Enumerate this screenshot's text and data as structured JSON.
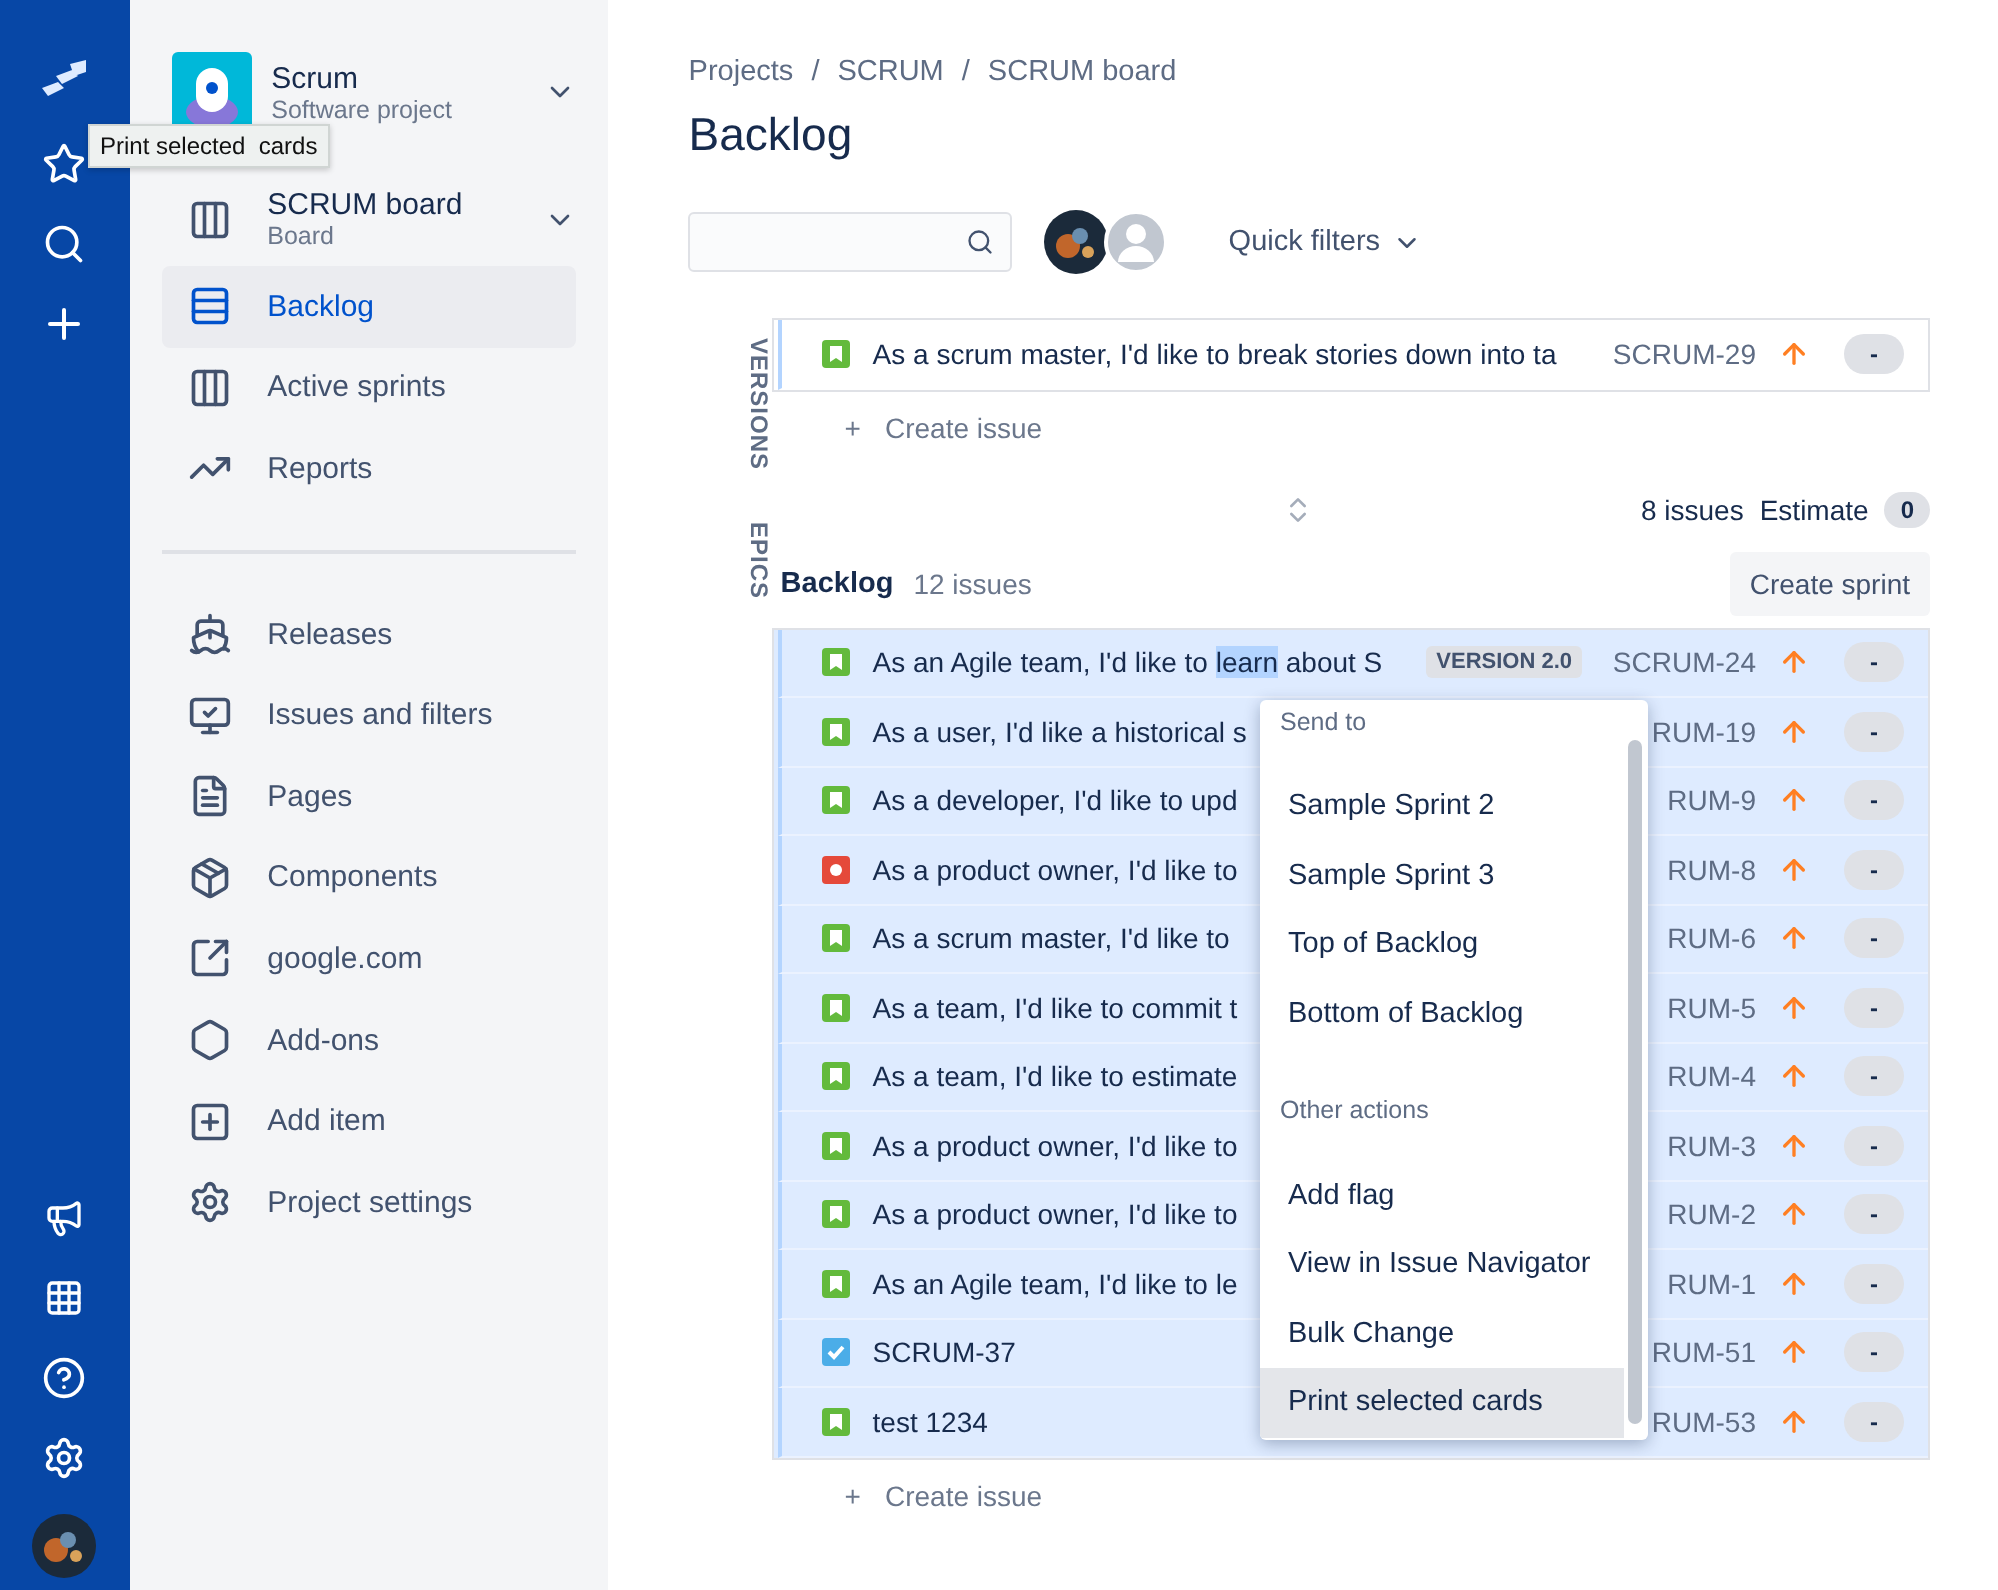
{
  "tooltip": {
    "text": "Print selected  cards"
  },
  "project": {
    "name": "Scrum",
    "type": "Software project"
  },
  "board": {
    "name": "SCRUM board",
    "type": "Board"
  },
  "sidebar": {
    "items": [
      {
        "label": "Backlog",
        "selected": true
      },
      {
        "label": "Active sprints",
        "selected": false
      },
      {
        "label": "Reports",
        "selected": false
      }
    ],
    "more_items": [
      {
        "label": "Releases"
      },
      {
        "label": "Issues and filters"
      },
      {
        "label": "Pages"
      },
      {
        "label": "Components"
      },
      {
        "label": "google.com"
      },
      {
        "label": "Add-ons"
      },
      {
        "label": "Add item"
      },
      {
        "label": "Project settings"
      }
    ]
  },
  "breadcrumbs": [
    {
      "label": "Projects"
    },
    {
      "separator": "/",
      "label": "SCRUM"
    },
    {
      "separator": "/",
      "label": "SCRUM board"
    }
  ],
  "title": "Backlog",
  "toolbar": {
    "quick_filters": "Quick filters"
  },
  "side_tabs": [
    "VERSIONS",
    "EPICS"
  ],
  "sprint": {
    "rows": [
      {
        "kind": "story",
        "summary": "As a scrum master, I'd like to break stories down into ta",
        "key": "SCRUM-29",
        "estimate": "-"
      }
    ],
    "create_issue": "Create issue",
    "create_icon": "+",
    "issues": "8 issues",
    "estimate_label": "Estimate",
    "estimate": "0"
  },
  "backlog": {
    "title": "Backlog",
    "count": "12 issues",
    "create_sprint": "Create sprint",
    "rows": [
      {
        "kind": "story",
        "selected": true,
        "summary": "As an Agile team, I'd like to ",
        "selected_text": "learn",
        "summary_end": " about S",
        "version": "VERSION 2.0",
        "key": "SCRUM-24",
        "estimate": "-"
      },
      {
        "kind": "story",
        "selected": true,
        "summary": "As a user, I'd like a historical s",
        "key": "RUM-19",
        "estimate": "-"
      },
      {
        "kind": "story",
        "selected": true,
        "summary": "As a developer, I'd like to upd",
        "key": "RUM-9",
        "estimate": "-"
      },
      {
        "kind": "bug",
        "selected": true,
        "summary": "As a product owner, I'd like to",
        "key": "RUM-8",
        "estimate": "-"
      },
      {
        "kind": "story",
        "selected": true,
        "summary": "As a scrum master, I'd like to",
        "key": "RUM-6",
        "estimate": "-"
      },
      {
        "kind": "story",
        "selected": true,
        "summary": "As a team, I'd like to commit t",
        "key": "RUM-5",
        "estimate": "-"
      },
      {
        "kind": "story",
        "selected": true,
        "summary": "As a team, I'd like to estimate",
        "key": "RUM-4",
        "estimate": "-"
      },
      {
        "kind": "story",
        "selected": true,
        "summary": "As a product owner, I'd like to",
        "key": "RUM-3",
        "estimate": "-"
      },
      {
        "kind": "story",
        "selected": true,
        "summary": "As a product owner, I'd like to",
        "key": "RUM-2",
        "estimate": "-"
      },
      {
        "kind": "story",
        "selected": true,
        "summary": "As an Agile team, I'd like to le",
        "key": "RUM-1",
        "estimate": "-"
      },
      {
        "kind": "task",
        "selected": true,
        "summary": "SCRUM-37",
        "key": "RUM-51",
        "estimate": "-"
      },
      {
        "kind": "story",
        "selected": true,
        "summary": "test 1234",
        "key": "RUM-53",
        "estimate": "-"
      }
    ],
    "create_issue": "Create issue",
    "create_icon": "+"
  },
  "context_menu": {
    "sections": [
      {
        "heading": "Send to",
        "items": [
          {
            "label": "Sample Sprint 2",
            "selected": false
          },
          {
            "label": "Sample Sprint 3",
            "selected": false
          },
          {
            "label": "Top of Backlog",
            "selected": false
          },
          {
            "label": "Bottom of Backlog",
            "selected": false
          }
        ]
      },
      {
        "heading": "Other actions",
        "items": [
          {
            "label": "Add flag",
            "selected": false
          },
          {
            "label": "View in Issue Navigator",
            "selected": false
          },
          {
            "label": "Bulk Change",
            "selected": false
          },
          {
            "label": "Print selected cards",
            "selected": true
          }
        ]
      }
    ]
  }
}
